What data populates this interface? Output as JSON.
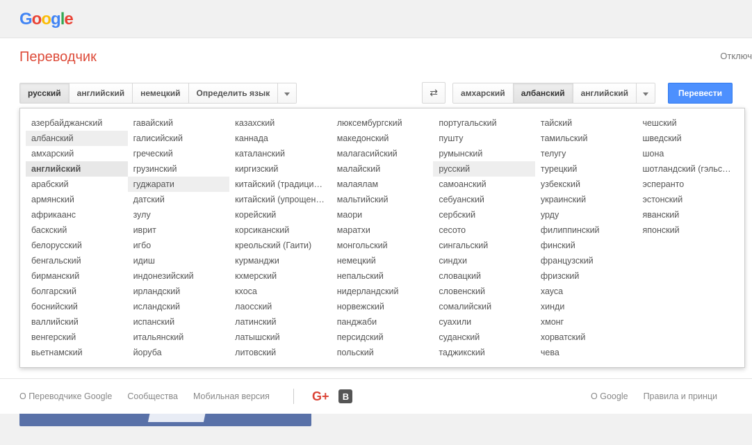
{
  "header": {
    "logo_parts": [
      "G",
      "o",
      "o",
      "g",
      "l",
      "e"
    ]
  },
  "title": "Переводчик",
  "disable_link": "Отключ",
  "toolbar": {
    "source_tabs": [
      "русский",
      "английский",
      "немецкий",
      "Определить язык"
    ],
    "source_active_index": 0,
    "target_tabs": [
      "амхарский",
      "албанский",
      "английский"
    ],
    "target_active_index": 1,
    "translate_label": "Перевести"
  },
  "lang_columns": [
    [
      "азербайджанский",
      "албанский",
      "амхарский",
      "английский",
      "арабский",
      "армянский",
      "африкаанс",
      "баскский",
      "белорусский",
      "бенгальский",
      "бирманский",
      "болгарский",
      "боснийский",
      "валлийский",
      "венгерский",
      "вьетнамский"
    ],
    [
      "гавайский",
      "галисийский",
      "греческий",
      "грузинский",
      "гуджарати",
      "датский",
      "зулу",
      "иврит",
      "игбо",
      "идиш",
      "индонезийский",
      "ирландский",
      "исландский",
      "испанский",
      "итальянский",
      "йоруба"
    ],
    [
      "казахский",
      "каннада",
      "каталанский",
      "киргизский",
      "китайский (традиционный)",
      "китайский (упрощенный)",
      "корейский",
      "корсиканский",
      "креольский (Гаити)",
      "курманджи",
      "кхмерский",
      "кхоса",
      "лаосский",
      "латинский",
      "латышский",
      "литовский"
    ],
    [
      "люксембургский",
      "македонский",
      "малагасийский",
      "малайский",
      "малаялам",
      "мальтийский",
      "маори",
      "маратхи",
      "монгольский",
      "немецкий",
      "непальский",
      "нидерландский",
      "норвежский",
      "панджаби",
      "персидский",
      "польский"
    ],
    [
      "португальский",
      "пушту",
      "румынский",
      "русский",
      "самоанский",
      "себуанский",
      "сербский",
      "сесото",
      "сингальский",
      "синдхи",
      "словацкий",
      "словенский",
      "сомалийский",
      "суахили",
      "суданский",
      "таджикский"
    ],
    [
      "тайский",
      "тамильский",
      "телугу",
      "турецкий",
      "узбекский",
      "украинский",
      "урду",
      "филиппинский",
      "финский",
      "французский",
      "фризский",
      "хауса",
      "хинди",
      "хмонг",
      "хорватский",
      "чева"
    ],
    [
      "чешский",
      "шведский",
      "шона",
      "шотландский (гэльский)",
      "эсперанто",
      "эстонский",
      "яванский",
      "японский"
    ]
  ],
  "lang_highlights": {
    "selected": [
      "английский"
    ],
    "hovered": [
      "албанский",
      "гуджарати",
      "русский"
    ]
  },
  "footer": {
    "left": [
      "О Переводчике Google",
      "Сообщества",
      "Мобильная версия"
    ],
    "right": [
      "О Google",
      "Правила и принци"
    ]
  }
}
